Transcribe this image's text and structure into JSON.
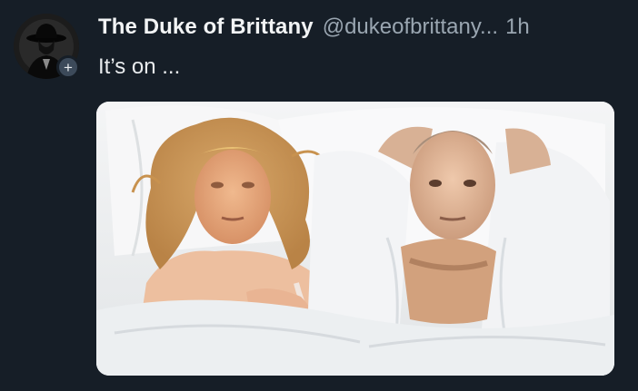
{
  "tweet": {
    "display_name": "The Duke of Brittany",
    "handle": "@dukeofbrittany...",
    "time": "1h",
    "text": "It’s on ...",
    "follow_badge": "+"
  },
  "icons": {
    "avatar": "hat-silhouette-avatar",
    "follow": "plus-icon"
  },
  "media": {
    "kind": "photo",
    "background": "#eef0f1"
  }
}
